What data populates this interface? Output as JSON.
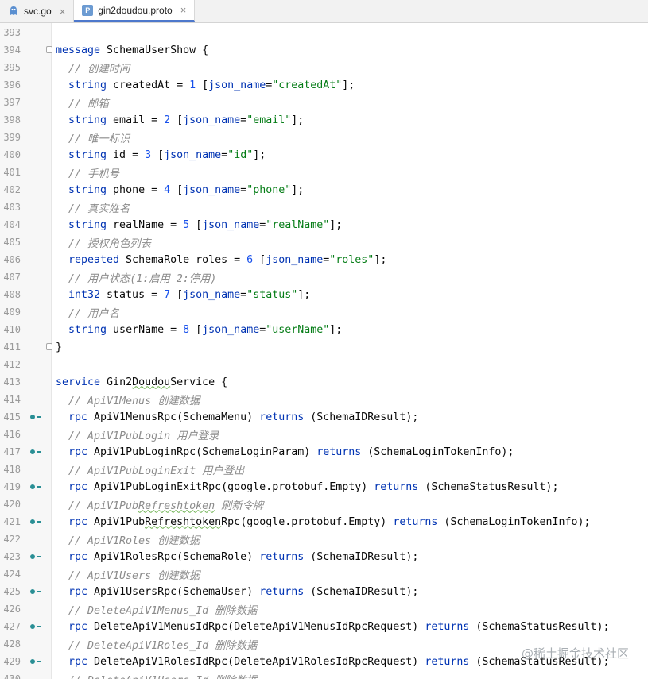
{
  "tabs": [
    {
      "label": "svc.go",
      "icon": "go-file-icon",
      "active": false
    },
    {
      "label": "gin2doudou.proto",
      "icon": "proto-file-icon",
      "active": true
    }
  ],
  "watermark": "@稀土掘金技术社区",
  "colors": {
    "keyword": "#0033b3",
    "number": "#1750eb",
    "string": "#067d17",
    "comment": "#8c8c8c",
    "accent": "#4d78cc"
  },
  "lines": [
    {
      "n": "393",
      "icon": "",
      "indent": 0,
      "tokens": []
    },
    {
      "n": "394",
      "icon": "fold",
      "indent": 0,
      "tokens": [
        [
          "kw",
          "message"
        ],
        [
          "t",
          " SchemaUserShow {"
        ]
      ]
    },
    {
      "n": "395",
      "icon": "",
      "indent": 1,
      "tokens": [
        [
          "cm",
          "// 创建时间"
        ]
      ]
    },
    {
      "n": "396",
      "icon": "",
      "indent": 1,
      "tokens": [
        [
          "kw",
          "string"
        ],
        [
          "t",
          " createdAt = "
        ],
        [
          "num",
          "1"
        ],
        [
          "t",
          " ["
        ],
        [
          "kw",
          "json_name"
        ],
        [
          "t",
          "="
        ],
        [
          "str",
          "\"createdAt\""
        ],
        [
          "t",
          "];"
        ]
      ]
    },
    {
      "n": "397",
      "icon": "",
      "indent": 1,
      "tokens": [
        [
          "cm",
          "// 邮箱"
        ]
      ]
    },
    {
      "n": "398",
      "icon": "",
      "indent": 1,
      "tokens": [
        [
          "kw",
          "string"
        ],
        [
          "t",
          " email = "
        ],
        [
          "num",
          "2"
        ],
        [
          "t",
          " ["
        ],
        [
          "kw",
          "json_name"
        ],
        [
          "t",
          "="
        ],
        [
          "str",
          "\"email\""
        ],
        [
          "t",
          "];"
        ]
      ]
    },
    {
      "n": "399",
      "icon": "",
      "indent": 1,
      "tokens": [
        [
          "cm",
          "// 唯一标识"
        ]
      ]
    },
    {
      "n": "400",
      "icon": "",
      "indent": 1,
      "tokens": [
        [
          "kw",
          "string"
        ],
        [
          "t",
          " id = "
        ],
        [
          "num",
          "3"
        ],
        [
          "t",
          " ["
        ],
        [
          "kw",
          "json_name"
        ],
        [
          "t",
          "="
        ],
        [
          "str",
          "\"id\""
        ],
        [
          "t",
          "];"
        ]
      ]
    },
    {
      "n": "401",
      "icon": "",
      "indent": 1,
      "tokens": [
        [
          "cm",
          "// 手机号"
        ]
      ]
    },
    {
      "n": "402",
      "icon": "",
      "indent": 1,
      "tokens": [
        [
          "kw",
          "string"
        ],
        [
          "t",
          " phone = "
        ],
        [
          "num",
          "4"
        ],
        [
          "t",
          " ["
        ],
        [
          "kw",
          "json_name"
        ],
        [
          "t",
          "="
        ],
        [
          "str",
          "\"phone\""
        ],
        [
          "t",
          "];"
        ]
      ]
    },
    {
      "n": "403",
      "icon": "",
      "indent": 1,
      "tokens": [
        [
          "cm",
          "// 真实姓名"
        ]
      ]
    },
    {
      "n": "404",
      "icon": "",
      "indent": 1,
      "tokens": [
        [
          "kw",
          "string"
        ],
        [
          "t",
          " realName = "
        ],
        [
          "num",
          "5"
        ],
        [
          "t",
          " ["
        ],
        [
          "kw",
          "json_name"
        ],
        [
          "t",
          "="
        ],
        [
          "str",
          "\"realName\""
        ],
        [
          "t",
          "];"
        ]
      ]
    },
    {
      "n": "405",
      "icon": "",
      "indent": 1,
      "tokens": [
        [
          "cm",
          "// 授权角色列表"
        ]
      ]
    },
    {
      "n": "406",
      "icon": "",
      "indent": 1,
      "tokens": [
        [
          "kw",
          "repeated"
        ],
        [
          "t",
          " SchemaRole roles = "
        ],
        [
          "num",
          "6"
        ],
        [
          "t",
          " ["
        ],
        [
          "kw",
          "json_name"
        ],
        [
          "t",
          "="
        ],
        [
          "str",
          "\"roles\""
        ],
        [
          "t",
          "];"
        ]
      ]
    },
    {
      "n": "407",
      "icon": "",
      "indent": 1,
      "tokens": [
        [
          "cm",
          "// 用户状态(1:启用 2:停用)"
        ]
      ]
    },
    {
      "n": "408",
      "icon": "",
      "indent": 1,
      "tokens": [
        [
          "kw",
          "int32"
        ],
        [
          "t",
          " status = "
        ],
        [
          "num",
          "7"
        ],
        [
          "t",
          " ["
        ],
        [
          "kw",
          "json_name"
        ],
        [
          "t",
          "="
        ],
        [
          "str",
          "\"status\""
        ],
        [
          "t",
          "];"
        ]
      ]
    },
    {
      "n": "409",
      "icon": "",
      "indent": 1,
      "tokens": [
        [
          "cm",
          "// 用户名"
        ]
      ]
    },
    {
      "n": "410",
      "icon": "",
      "indent": 1,
      "tokens": [
        [
          "kw",
          "string"
        ],
        [
          "t",
          " userName = "
        ],
        [
          "num",
          "8"
        ],
        [
          "t",
          " ["
        ],
        [
          "kw",
          "json_name"
        ],
        [
          "t",
          "="
        ],
        [
          "str",
          "\"userName\""
        ],
        [
          "t",
          "];"
        ]
      ]
    },
    {
      "n": "411",
      "icon": "fold",
      "indent": 0,
      "tokens": [
        [
          "t",
          "}"
        ]
      ]
    },
    {
      "n": "412",
      "icon": "",
      "indent": 0,
      "tokens": []
    },
    {
      "n": "413",
      "icon": "",
      "indent": 0,
      "tokens": [
        [
          "kw",
          "service"
        ],
        [
          "t",
          " Gin2"
        ],
        [
          "w",
          "Doudou"
        ],
        [
          "t",
          "Service {"
        ]
      ]
    },
    {
      "n": "414",
      "icon": "",
      "indent": 1,
      "tokens": [
        [
          "cm",
          "// ApiV1Menus 创建数据"
        ]
      ]
    },
    {
      "n": "415",
      "icon": "impl",
      "indent": 1,
      "tokens": [
        [
          "kw",
          "rpc"
        ],
        [
          "t",
          " ApiV1MenusRpc(SchemaMenu) "
        ],
        [
          "kw",
          "returns"
        ],
        [
          "t",
          " (SchemaIDResult);"
        ]
      ]
    },
    {
      "n": "416",
      "icon": "",
      "indent": 1,
      "tokens": [
        [
          "cm",
          "// ApiV1PubLogin 用户登录"
        ]
      ]
    },
    {
      "n": "417",
      "icon": "impl",
      "indent": 1,
      "tokens": [
        [
          "kw",
          "rpc"
        ],
        [
          "t",
          " ApiV1PubLoginRpc(SchemaLoginParam) "
        ],
        [
          "kw",
          "returns"
        ],
        [
          "t",
          " (SchemaLoginTokenInfo);"
        ]
      ]
    },
    {
      "n": "418",
      "icon": "",
      "indent": 1,
      "tokens": [
        [
          "cm",
          "// ApiV1PubLoginExit 用户登出"
        ]
      ]
    },
    {
      "n": "419",
      "icon": "impl",
      "indent": 1,
      "tokens": [
        [
          "kw",
          "rpc"
        ],
        [
          "t",
          " ApiV1PubLoginExitRpc(google.protobuf.Empty) "
        ],
        [
          "kw",
          "returns"
        ],
        [
          "t",
          " (SchemaStatusResult);"
        ]
      ]
    },
    {
      "n": "420",
      "icon": "",
      "indent": 1,
      "tokens": [
        [
          "cm",
          "// ApiV1Pub"
        ],
        [
          "cmw",
          "Refreshtoken"
        ],
        [
          "cm",
          " 刷新令牌"
        ]
      ]
    },
    {
      "n": "421",
      "icon": "impl",
      "indent": 1,
      "tokens": [
        [
          "kw",
          "rpc"
        ],
        [
          "t",
          " ApiV1Pub"
        ],
        [
          "w",
          "Refreshtoken"
        ],
        [
          "t",
          "Rpc(google.protobuf.Empty) "
        ],
        [
          "kw",
          "returns"
        ],
        [
          "t",
          " (SchemaLoginTokenInfo);"
        ]
      ]
    },
    {
      "n": "422",
      "icon": "",
      "indent": 1,
      "tokens": [
        [
          "cm",
          "// ApiV1Roles 创建数据"
        ]
      ]
    },
    {
      "n": "423",
      "icon": "impl",
      "indent": 1,
      "tokens": [
        [
          "kw",
          "rpc"
        ],
        [
          "t",
          " ApiV1RolesRpc(SchemaRole) "
        ],
        [
          "kw",
          "returns"
        ],
        [
          "t",
          " (SchemaIDResult);"
        ]
      ]
    },
    {
      "n": "424",
      "icon": "",
      "indent": 1,
      "tokens": [
        [
          "cm",
          "// ApiV1Users 创建数据"
        ]
      ]
    },
    {
      "n": "425",
      "icon": "impl",
      "indent": 1,
      "tokens": [
        [
          "kw",
          "rpc"
        ],
        [
          "t",
          " ApiV1UsersRpc(SchemaUser) "
        ],
        [
          "kw",
          "returns"
        ],
        [
          "t",
          " (SchemaIDResult);"
        ]
      ]
    },
    {
      "n": "426",
      "icon": "",
      "indent": 1,
      "tokens": [
        [
          "cm",
          "// DeleteApiV1Menus_Id 删除数据"
        ]
      ]
    },
    {
      "n": "427",
      "icon": "impl",
      "indent": 1,
      "tokens": [
        [
          "kw",
          "rpc"
        ],
        [
          "t",
          " DeleteApiV1MenusIdRpc(DeleteApiV1MenusIdRpcRequest) "
        ],
        [
          "kw",
          "returns"
        ],
        [
          "t",
          " (SchemaStatusResult);"
        ]
      ]
    },
    {
      "n": "428",
      "icon": "",
      "indent": 1,
      "tokens": [
        [
          "cm",
          "// DeleteApiV1Roles_Id 删除数据"
        ]
      ]
    },
    {
      "n": "429",
      "icon": "impl",
      "indent": 1,
      "tokens": [
        [
          "kw",
          "rpc"
        ],
        [
          "t",
          " DeleteApiV1RolesIdRpc(DeleteApiV1RolesIdRpcRequest) "
        ],
        [
          "kw",
          "returns"
        ],
        [
          "t",
          " (SchemaStatusResult);"
        ]
      ]
    },
    {
      "n": "430",
      "icon": "",
      "indent": 1,
      "tokens": [
        [
          "cm",
          "// DeleteApiV1Users_Id 删除数据"
        ]
      ]
    }
  ]
}
